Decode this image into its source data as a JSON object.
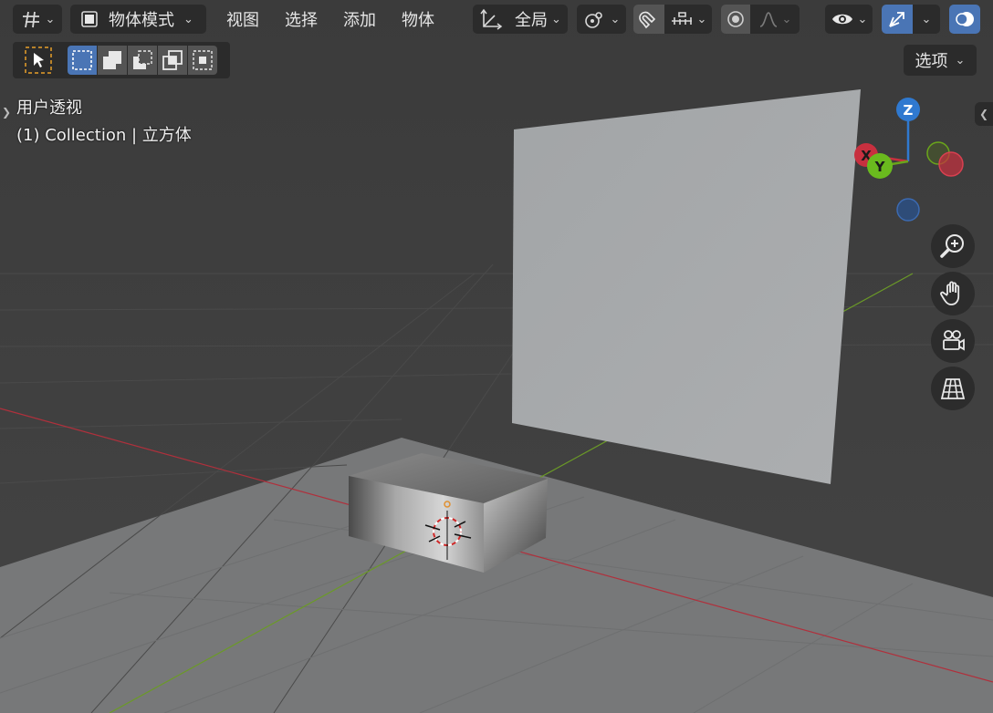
{
  "header": {
    "mode_label": "物体模式",
    "menus": [
      "视图",
      "选择",
      "添加",
      "物体"
    ],
    "transform_orientation": "全局",
    "options_label": "选项"
  },
  "viewport": {
    "view_name": "用户透视",
    "collection_label": "(1) Collection | 立方体"
  },
  "gizmo": {
    "z_label": "Z",
    "x_label": "X",
    "y_label": "Y"
  },
  "colors": {
    "accent": "#4a75b5",
    "axis_x": "#c8303f",
    "axis_y": "#6aa51b",
    "axis_z": "#2f79d0",
    "background": "#3d3d3d"
  },
  "icons": {
    "editor_type": "editor-type-icon",
    "object_mode": "object-mode-icon",
    "transform_orientation": "transform-orientation-icon",
    "pivot": "pivot-icon",
    "snap": "snap-magnet-icon",
    "snap_target": "snap-increment-icon",
    "proportional": "proportional-edit-icon",
    "falloff": "falloff-curve-icon",
    "visibility": "eye-icon",
    "gizmo_toggle": "gizmo-icon",
    "overlays": "overlays-icon",
    "zoom": "zoom-icon",
    "pan": "hand-icon",
    "camera": "camera-icon",
    "projection": "grid-perspective-icon"
  }
}
